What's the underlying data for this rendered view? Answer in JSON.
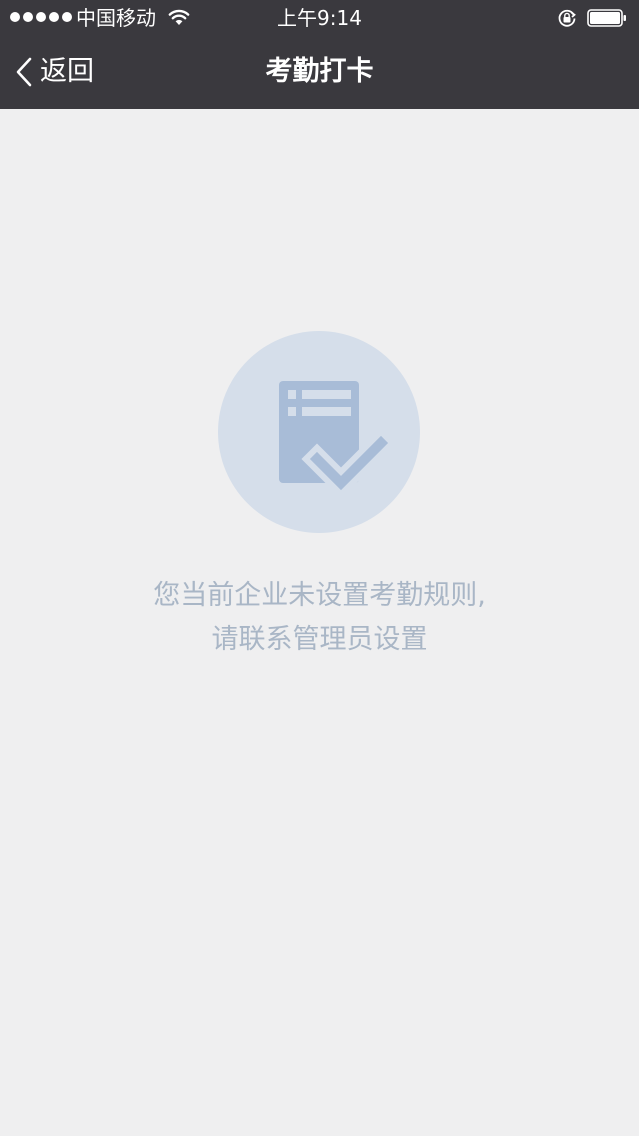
{
  "status_bar": {
    "carrier": "中国移动",
    "time": "上午9:14",
    "signal_bars": 5,
    "battery_level": 1.0
  },
  "nav_bar": {
    "back_label": "返回",
    "title": "考勤打卡"
  },
  "empty_state": {
    "message_line1": "您当前企业未设置考勤规则,",
    "message_line2": "请联系管理员设置"
  },
  "colors": {
    "nav_background": "#3a393e",
    "page_background": "#efeff0",
    "illustration_circle": "#d5deea",
    "illustration_icon": "#a8bcd7",
    "message_text": "#a9b6c6"
  },
  "icons": {
    "back": "chevron-left-icon",
    "wifi": "wifi-icon",
    "orientation_lock": "orientation-lock-icon",
    "battery": "battery-icon",
    "empty": "checklist-document-icon"
  }
}
